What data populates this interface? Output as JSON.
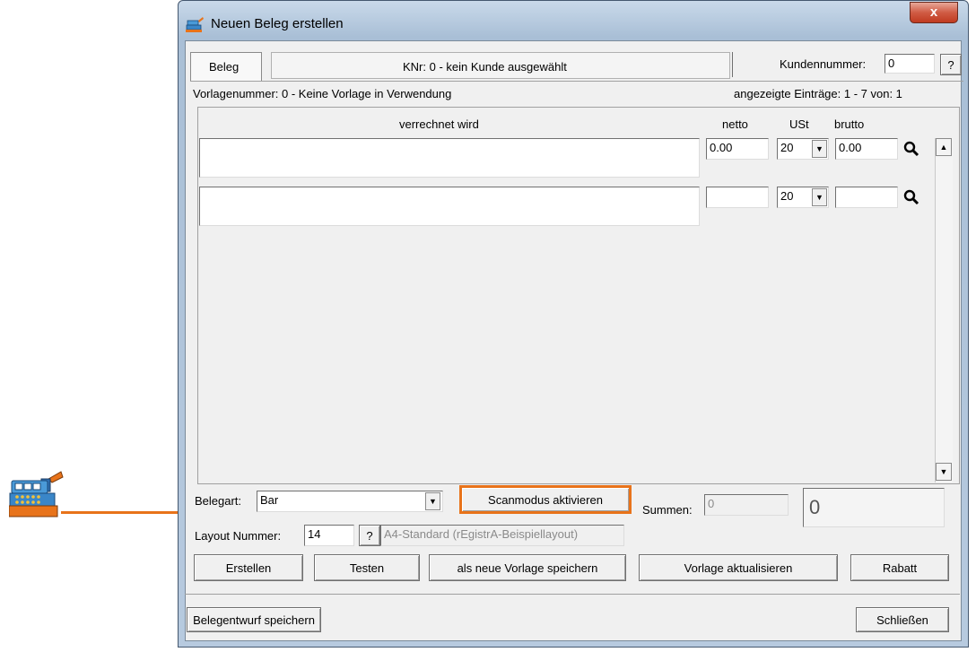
{
  "window": {
    "title": "Neuen Beleg erstellen",
    "close_label": "x"
  },
  "header": {
    "tab_label": "Beleg",
    "customer_info": "KNr: 0 - kein Kunde ausgewählt",
    "customer_number_label": "Kundennummer:",
    "customer_number_value": "0",
    "help_label": "?"
  },
  "info": {
    "template_text": "Vorlagenummer: 0 - Keine Vorlage in Verwendung",
    "entries_text": "angezeigte Einträge: 1 - 7 von: 1"
  },
  "columns": {
    "description": "verrechnet wird",
    "net": "netto",
    "vat": "USt",
    "gross": "brutto"
  },
  "rows": [
    {
      "description": "",
      "net": "0.00",
      "vat": "20",
      "gross": "0.00"
    },
    {
      "description": "",
      "net": "",
      "vat": "20",
      "gross": ""
    }
  ],
  "footer": {
    "receipt_type_label": "Belegart:",
    "receipt_type_value": "Bar",
    "scan_button": "Scanmodus aktivieren",
    "sums_label": "Summen:",
    "sums_value": "0",
    "sum_display": "0",
    "layout_label": "Layout Nummer:",
    "layout_value": "14",
    "layout_help": "?",
    "layout_name": "A4-Standard (rEgistrA-Beispiellayout)",
    "buttons": {
      "create": "Erstellen",
      "test": "Testen",
      "save_template": "als neue Vorlage speichern",
      "update_template": "Vorlage aktualisieren",
      "discount": "Rabatt"
    },
    "save_draft": "Belegentwurf speichern",
    "close": "Schließen"
  },
  "colors": {
    "highlight": "#e8731a",
    "window_frame": "#b7cadf",
    "close_button": "#c8452c"
  },
  "icons": {
    "app": "cash-register-icon",
    "search": "magnifier-icon"
  }
}
